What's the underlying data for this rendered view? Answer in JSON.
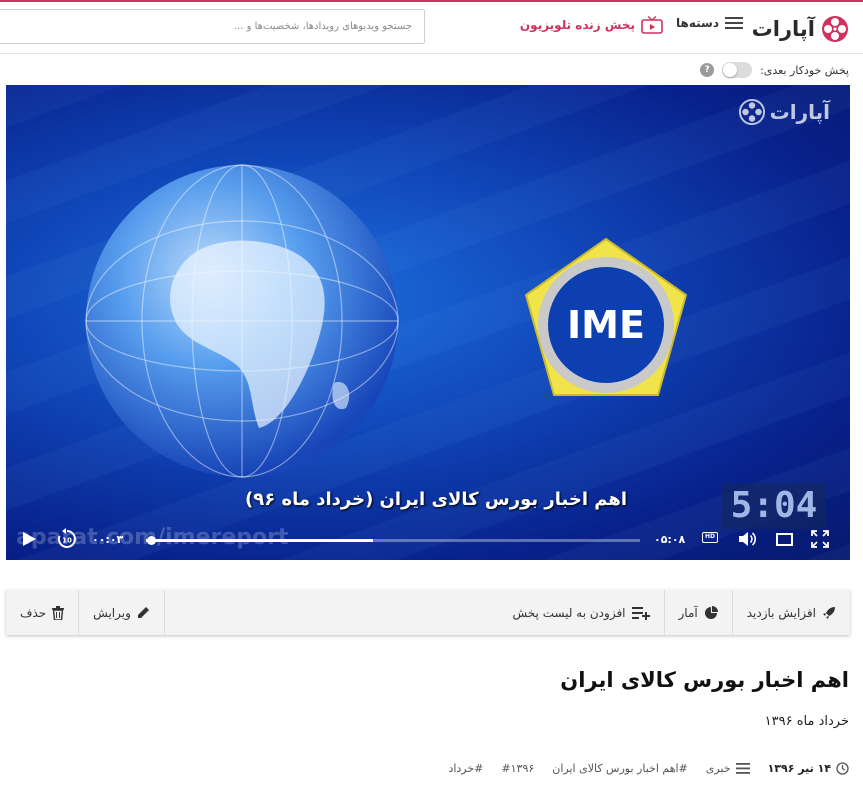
{
  "header": {
    "brand": "آپارات",
    "categories_label": "دسته‌ها",
    "live_label": "پخش زنده تلویزیون",
    "search_placeholder": "جستجو ویدیوهای رویدادها، شخصیت‌ها و ..."
  },
  "autoplay": {
    "label": "پخش خودکار بعدی:",
    "enabled": false,
    "help": "?"
  },
  "player": {
    "watermark": "آپارات",
    "overlay_caption": "اهم اخبار بورس کالای ایران (خرداد ماه ۹۶)",
    "emblem_text": "IME",
    "clock_text": "5:04",
    "ghost_text": "aparat.com/imereport",
    "current_time": "۰۰:۰۳",
    "duration": "۰۵:۰۸",
    "buffered": 0.46,
    "progress": 0.01,
    "hd_label": "HD",
    "rewind_label": "10"
  },
  "actions": {
    "boost": "افزایش بازدید",
    "stats": "آمار",
    "add_playlist": "افزودن به لیست پخش",
    "edit": "ویرایش",
    "delete": "حذف"
  },
  "video": {
    "title": "اهم اخبار بورس کالای ایران",
    "description": "خرداد ماه ۱۳۹۶",
    "date": "۱۴ تیر ۱۳۹۶",
    "category": "خبری",
    "tags": [
      "#اهم اخبار بورس کالای ایران",
      "#۱۳۹۶",
      "#خرداد"
    ]
  },
  "colors": {
    "accent": "#d1315c",
    "player_blue": "#0e3fb0"
  }
}
